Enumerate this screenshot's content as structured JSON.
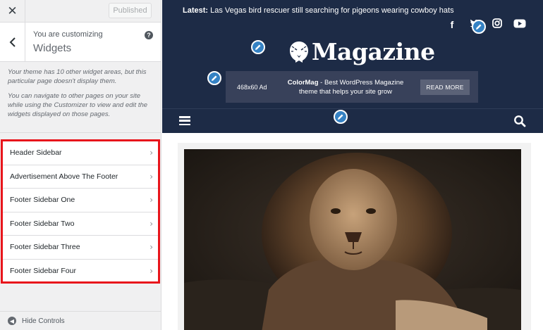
{
  "sidebar": {
    "close_icon": "close-icon",
    "publish_label": "Published",
    "customizing_label": "You are customizing",
    "section_title": "Widgets",
    "help_icon_text": "?",
    "description": [
      "Your theme has 10 other widget areas, but this particular page doesn't display them.",
      "You can navigate to other pages on your site while using the Customizer to view and edit the widgets displayed on those pages."
    ],
    "widget_areas": [
      "Header Sidebar",
      "Advertisement Above The Footer",
      "Footer Sidebar One",
      "Footer Sidebar Two",
      "Footer Sidebar Three",
      "Footer Sidebar Four"
    ],
    "highlight_color": "#e8141b",
    "hide_controls_label": "Hide Controls"
  },
  "preview": {
    "latest_label": "Latest:",
    "latest_headline": "Las Vegas bird rescuer still searching for pigeons wearing cowboy hats",
    "social_icons": [
      "facebook-icon",
      "twitter-icon",
      "instagram-icon",
      "youtube-icon"
    ],
    "site_title": "Magazine",
    "ad": {
      "size_label": "468x60 Ad",
      "brand": "ColorMag",
      "text": " - Best WordPress Magazine theme that helps your site grow",
      "button_label": "READ MORE"
    },
    "colors": {
      "header_bg": "#1d2b46",
      "ad_bg": "#38415a",
      "edit_shortcut": "#3582c4"
    }
  }
}
